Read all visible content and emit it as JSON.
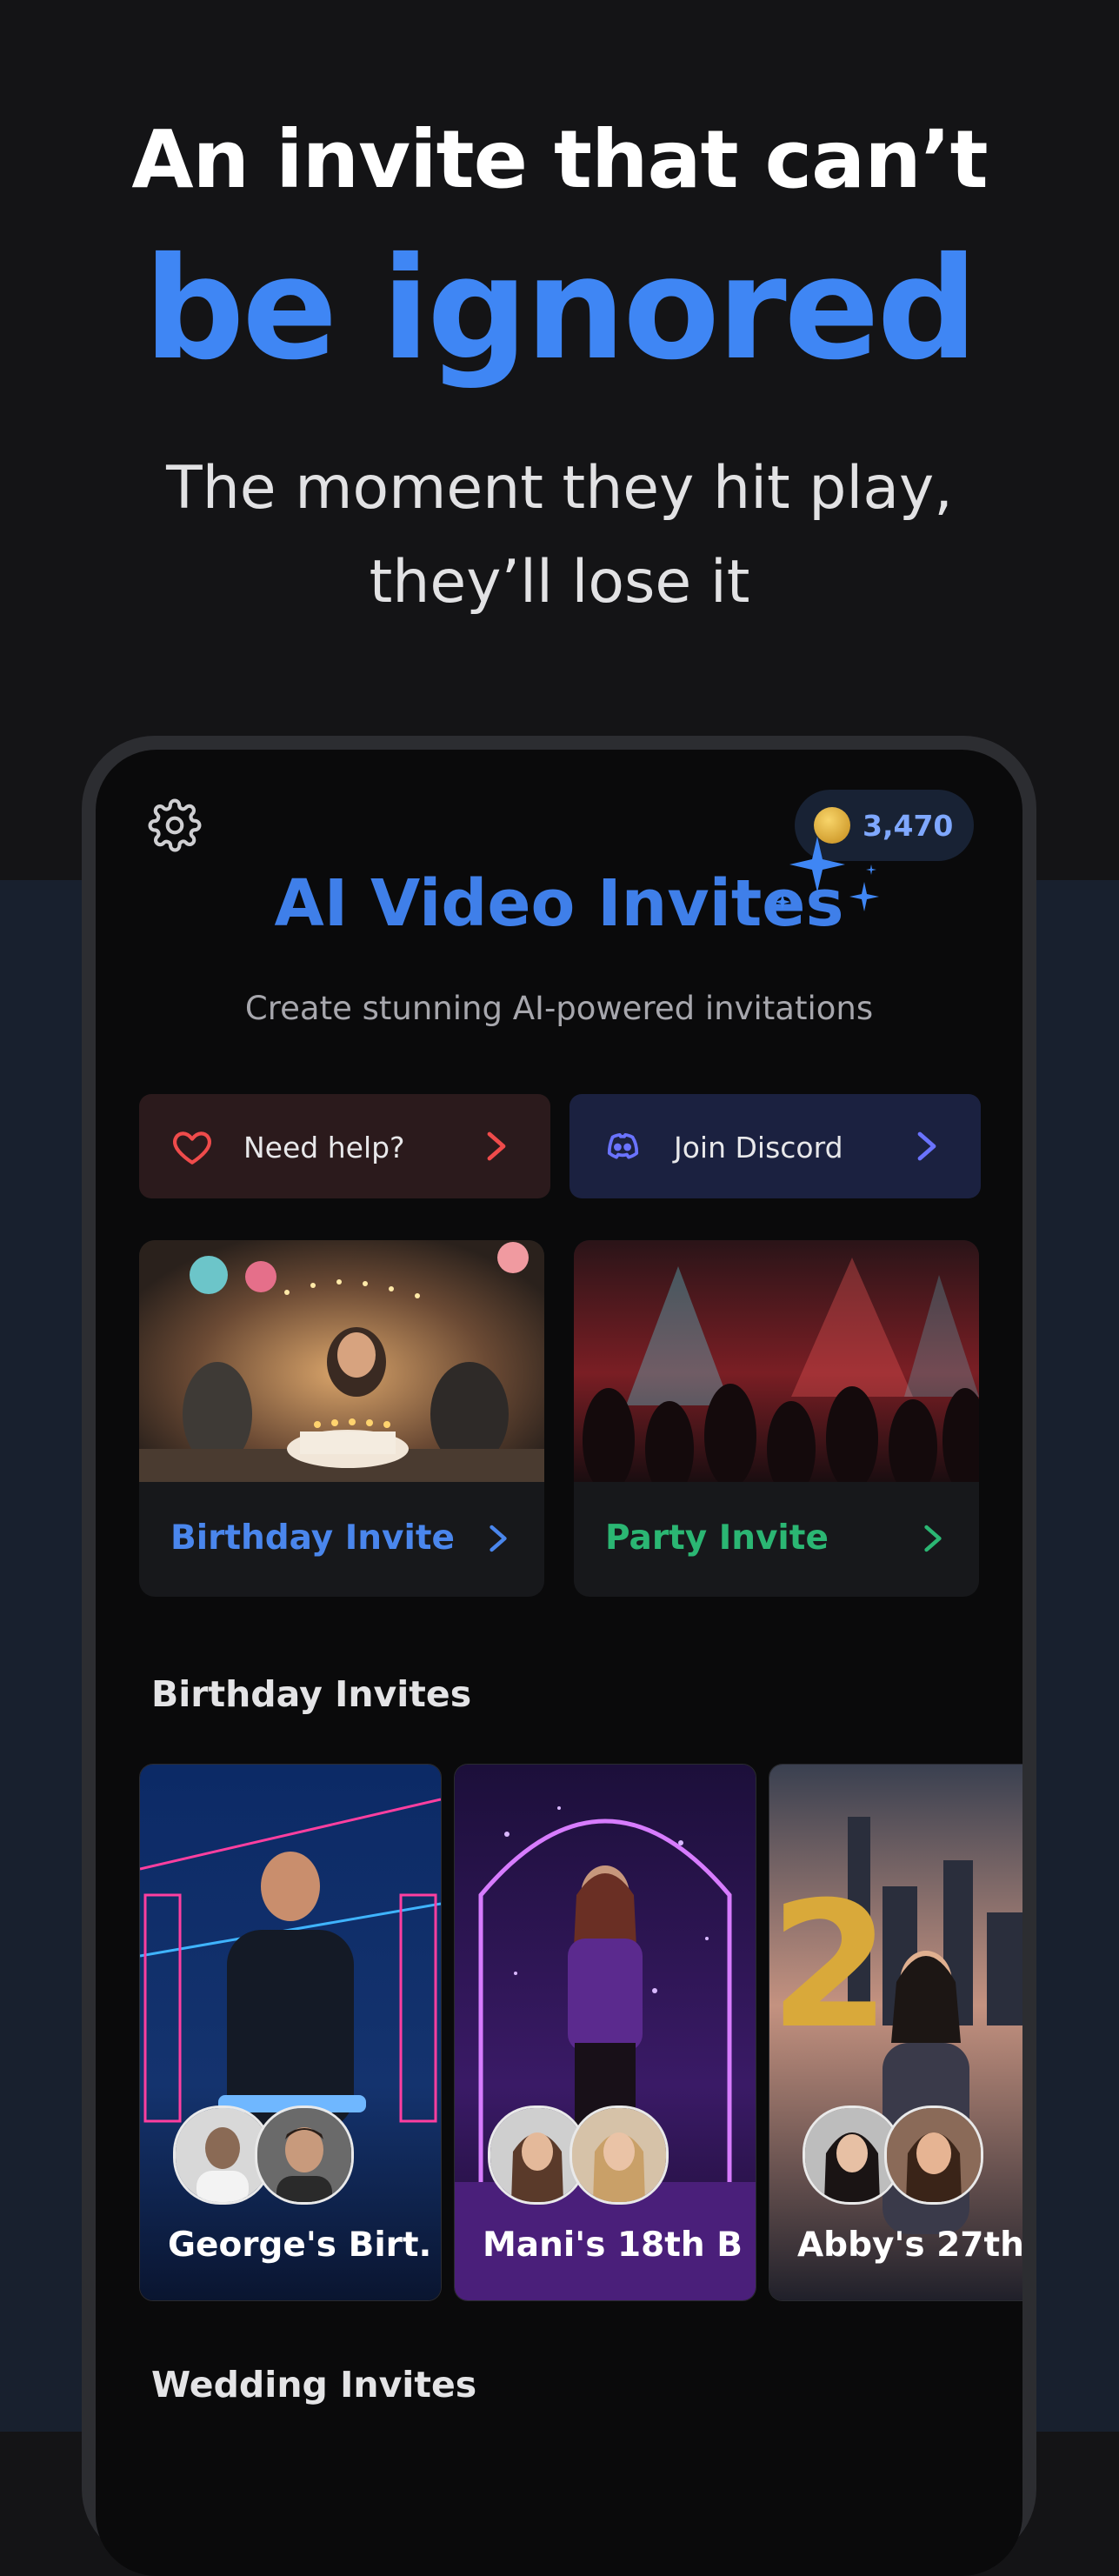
{
  "hero": {
    "line1": "An invite that can’t",
    "line2": "be ignored",
    "subtitle_line1": "The moment they hit play,",
    "subtitle_line2": "they’ll lose it"
  },
  "app": {
    "coins": "3,470",
    "title": "AI Video Invites",
    "tagline": "Create stunning AI-powered invitations",
    "help_button": "Need help?",
    "discord_button": "Join Discord",
    "categories": [
      {
        "label": "Birthday Invite",
        "color": "#4a86ec"
      },
      {
        "label": "Party Invite",
        "color": "#2bb673"
      }
    ],
    "sections": {
      "birthday": "Birthday Invites",
      "wedding": "Wedding Invites"
    },
    "birthday_invites": [
      {
        "name": "George's Birt..."
      },
      {
        "name": "Mani's 18th B..."
      },
      {
        "name": "Abby's 27th ..."
      }
    ]
  },
  "icons": [
    "gear-icon",
    "coin-icon",
    "sparkle-icon",
    "heart-icon",
    "discord-icon",
    "chevron-right-icon"
  ],
  "colors": {
    "accent": "#3f86f4",
    "background": "#141416",
    "help_red": "#ef4b4b",
    "discord_blue": "#6a73ff"
  }
}
